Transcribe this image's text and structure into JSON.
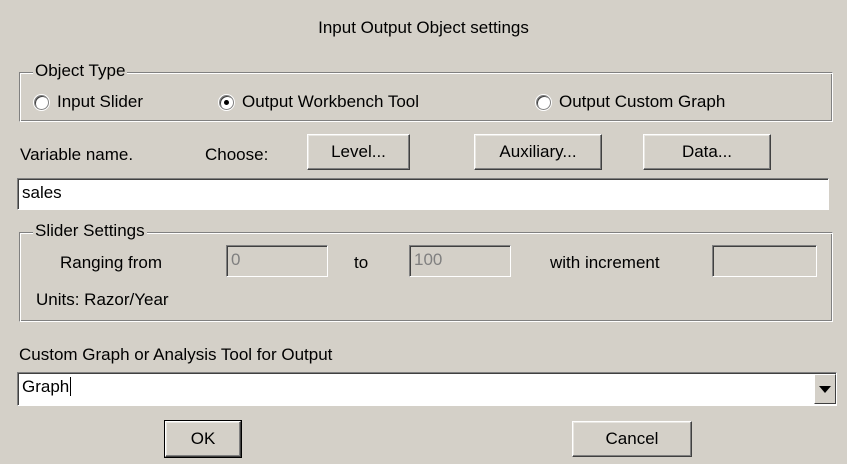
{
  "window": {
    "title": "Input Output Object settings"
  },
  "object_type": {
    "legend": "Object Type",
    "options": [
      {
        "label": "Input Slider",
        "checked": false
      },
      {
        "label": "Output Workbench Tool",
        "checked": true
      },
      {
        "label": "Output Custom Graph",
        "checked": false
      }
    ]
  },
  "variable": {
    "label": "Variable name.",
    "choose_label": "Choose:",
    "buttons": {
      "level": "Level...",
      "auxiliary": "Auxiliary...",
      "data": "Data..."
    },
    "value": "sales"
  },
  "slider_settings": {
    "legend": "Slider Settings",
    "ranging_label": "Ranging from",
    "from_value": "0",
    "to_label": "to",
    "to_value": "100",
    "increment_label": "with increment",
    "increment_value": "",
    "units_text": "Units: Razor/Year"
  },
  "output_tool": {
    "label": "Custom Graph or Analysis Tool for Output",
    "selected_value": "Graph"
  },
  "footer": {
    "ok_label": "OK",
    "cancel_label": "Cancel"
  }
}
